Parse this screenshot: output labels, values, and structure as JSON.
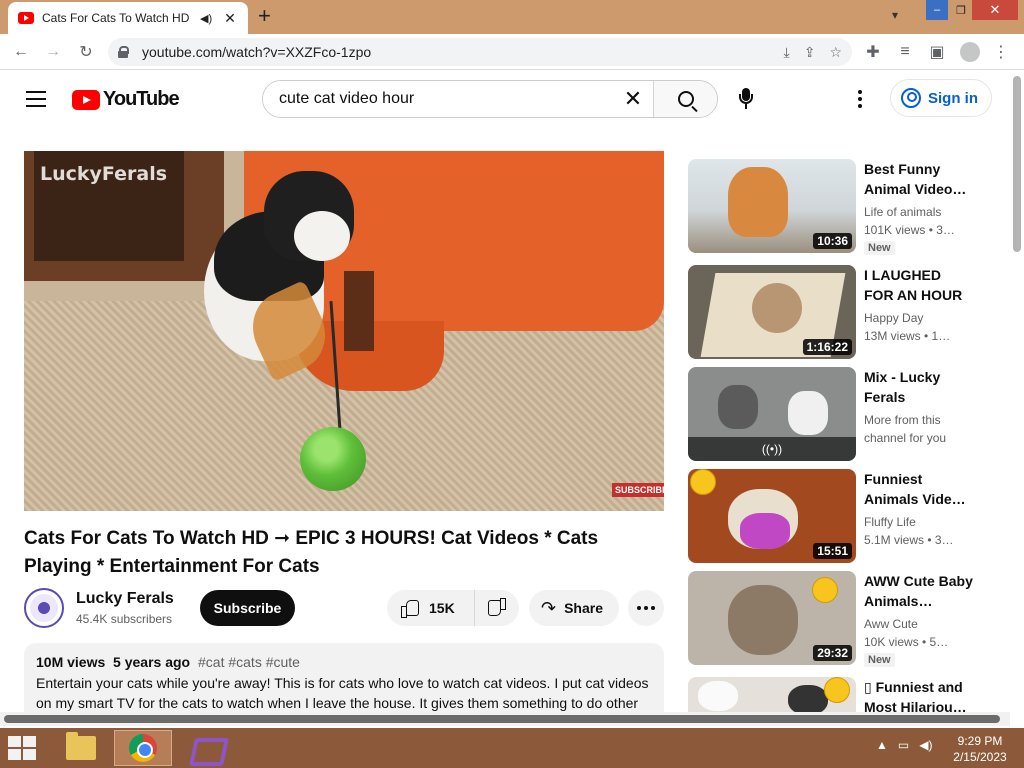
{
  "browser": {
    "tab_title": "Cats For Cats To Watch HD -",
    "new_tab": "+",
    "url": "youtube.com/watch?v=XXZFco-1zpo",
    "window_controls": {
      "minimize": "–",
      "maximize": "❐",
      "close": "✕"
    }
  },
  "youtube": {
    "logo_text": "YouTube",
    "search_value": "cute cat video hour",
    "signin_label": "Sign in"
  },
  "video": {
    "watermark": "LuckyFerals",
    "subscribe_watermark": "SUBSCRIBE",
    "title": "Cats For Cats To Watch HD ➞ EPIC 3 HOURS! Cat Videos * Cats Playing * Entertainment For Cats",
    "channel_name": "Lucky Ferals",
    "subscribers": "45.4K subscribers",
    "subscribe_label": "Subscribe",
    "like_count": "15K",
    "share_label": "Share",
    "description": {
      "views": "10M views",
      "age": "5 years ago",
      "tags": "#cat #cats #cute",
      "text": "Entertain your cats while you're away! This is for cats who love to watch cat videos. I put cat videos on my smart TV for the cats to watch when I leave the house. It gives them something to do other"
    }
  },
  "recommendations": [
    {
      "title": "Best Funny Animal Video…",
      "channel": "Life of animals",
      "stats": "101K views • 3…",
      "duration": "10:36",
      "badge": "New"
    },
    {
      "title": "I LAUGHED FOR AN HOUR😿…",
      "channel": "Happy Day",
      "stats": "13M views • 1…",
      "duration": "1:16:22",
      "badge": ""
    },
    {
      "title": "Mix - Lucky Ferals",
      "channel": "More from this",
      "stats": "channel for you",
      "duration": "",
      "mix_label": "((•))",
      "badge": ""
    },
    {
      "title": "Funniest Animals Vide…",
      "channel": "Fluffy Life",
      "stats": "5.1M views • 3…",
      "duration": "15:51",
      "badge": ""
    },
    {
      "title": "AWW Cute Baby Animals…",
      "channel": "Aww Cute",
      "stats": "10K views • 5…",
      "duration": "29:32",
      "badge": "New"
    },
    {
      "title": "▯ Funniest and Most Hilariou…",
      "channel": "",
      "stats": "",
      "duration": "",
      "badge": ""
    }
  ],
  "taskbar": {
    "time": "9:29 PM",
    "date": "2/15/2023"
  },
  "icons": {
    "tab_audio": "speaker-icon",
    "back": "back-arrow-icon",
    "forward": "forward-arrow-icon",
    "reload": "reload-icon",
    "lock": "lock-icon",
    "install": "install-icon",
    "share": "share-icon",
    "bookmark": "star-icon",
    "extensions": "puzzle-icon",
    "media": "media-icon",
    "sidepanel": "side-panel-icon",
    "profile": "avatar-icon",
    "menu": "kebab-icon"
  },
  "colors": {
    "youtube_red": "#ff0000",
    "signin_blue": "#065fd4",
    "tabstrip": "#cd9a6e",
    "taskbar": "#8c5a3a"
  }
}
